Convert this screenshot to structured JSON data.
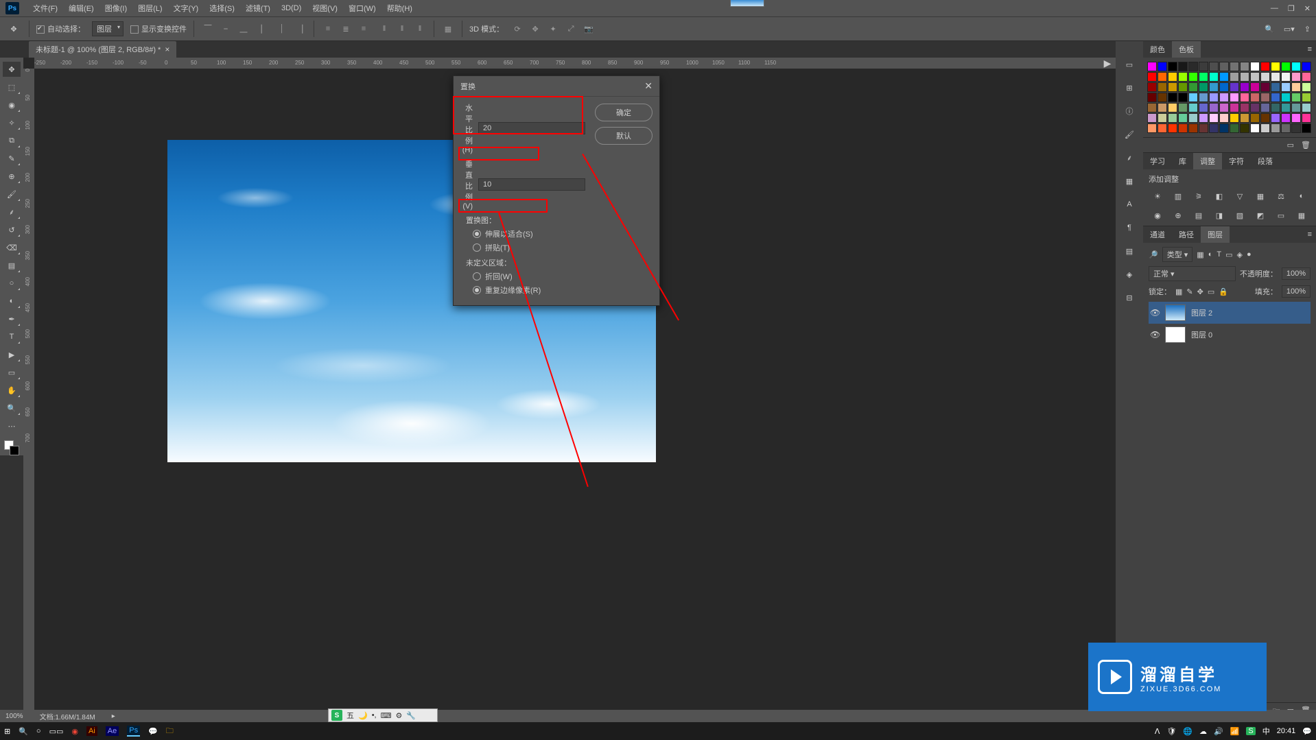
{
  "menubar": {
    "items": [
      "文件(F)",
      "编辑(E)",
      "图像(I)",
      "图层(L)",
      "文字(Y)",
      "选择(S)",
      "滤镜(T)",
      "3D(D)",
      "视图(V)",
      "窗口(W)",
      "帮助(H)"
    ]
  },
  "optbar": {
    "auto_select_label": "自动选择：",
    "auto_select_value": "图层",
    "show_transform_label": "显示变换控件",
    "mode3d_label": "3D 模式："
  },
  "tab": {
    "title": "未标题-1 @ 100% (图层 2, RGB/8#) *"
  },
  "ruler_h": [
    -250,
    -200,
    -150,
    -100,
    -50,
    0,
    50,
    100,
    150,
    200,
    250,
    300,
    350,
    400,
    450,
    500,
    550,
    600,
    650,
    700,
    750,
    800,
    850,
    900,
    950,
    1000,
    1050,
    1100,
    1150
  ],
  "ruler_v": [
    0,
    50,
    100,
    150,
    200,
    250,
    300,
    350,
    400,
    450,
    500,
    550,
    600,
    650,
    700
  ],
  "dialog": {
    "title": "置换",
    "h_ratio_label": "水平比例(H)",
    "h_ratio_value": "20",
    "v_ratio_label": "垂直比例(V)",
    "v_ratio_value": "10",
    "group1_label": "置换图：",
    "opt_stretch": "伸展以适合(S)",
    "opt_tile": "拼贴(T)",
    "group2_label": "未定义区域：",
    "opt_wrap": "折回(W)",
    "opt_repeat": "重复边缘像素(R)",
    "ok": "确定",
    "default": "默认"
  },
  "panels": {
    "color_tabs": [
      "颜色",
      "色板"
    ],
    "adjust_tabs": [
      "学习",
      "库",
      "调整",
      "字符",
      "段落"
    ],
    "adjust_title": "添加调整",
    "layers_tabs": [
      "通道",
      "路径",
      "图层"
    ],
    "layer_filter_label": "类型",
    "blend_mode": "正常",
    "opacity_label": "不透明度：",
    "opacity_value": "100%",
    "lock_label": "锁定：",
    "fill_label": "填充：",
    "fill_value": "100%",
    "layers": [
      {
        "name": "图层 2",
        "visible": true,
        "thumb": "sky"
      },
      {
        "name": "图层 0",
        "visible": true,
        "thumb": "white"
      }
    ]
  },
  "status": {
    "zoom": "100%",
    "doc": "文档:1.66M/1.84M"
  },
  "ime": {
    "label": "五"
  },
  "taskbar": {
    "time": "20:41"
  },
  "watermark": {
    "big": "溜溜自学",
    "small": "ZIXUE.3D66.COM"
  },
  "swatches": [
    "#ff00ff",
    "#0000ff",
    "#000000",
    "#181818",
    "#2a2a2a",
    "#3c3c3c",
    "#4e4e4e",
    "#606060",
    "#727272",
    "#848484",
    "#ffffff",
    "#ff0000",
    "#ffff00",
    "#00ff00",
    "#00ffff",
    "#0000ff",
    "#ff0000",
    "#ff6600",
    "#ffcc00",
    "#99ff00",
    "#33ff00",
    "#00ff66",
    "#00ffcc",
    "#0099ff",
    "#9f9f9f",
    "#b1b1b1",
    "#c3c3c3",
    "#d5d5d5",
    "#e7e7e7",
    "#f3f3f3",
    "#ff99cc",
    "#ff6699",
    "#990000",
    "#996600",
    "#cc9900",
    "#669900",
    "#339933",
    "#009966",
    "#3399cc",
    "#0066cc",
    "#6633cc",
    "#9900cc",
    "#cc0099",
    "#660033",
    "#336699",
    "#99ccff",
    "#ffcc99",
    "#ccff99",
    "#660000",
    "#663300",
    "#000000",
    "#000000",
    "#66ccff",
    "#6699cc",
    "#9999ff",
    "#cc99ff",
    "#ff99ff",
    "#ff6699",
    "#cc6666",
    "#996666",
    "#3366cc",
    "#00cccc",
    "#66cc66",
    "#99cc33",
    "#996633",
    "#cc9966",
    "#ffcc66",
    "#669966",
    "#66cccc",
    "#6666cc",
    "#9966cc",
    "#cc66cc",
    "#cc3399",
    "#993366",
    "#663366",
    "#666699",
    "#336666",
    "#339999",
    "#669999",
    "#99cccc",
    "#cc99cc",
    "#cccc99",
    "#99cc99",
    "#66cc99",
    "#99ccCC",
    "#cc99ff",
    "#ffccff",
    "#ffcccc",
    "#ffcc00",
    "#cc9933",
    "#996600",
    "#663300",
    "#9966ff",
    "#cc33ff",
    "#ff66ff",
    "#ff3399",
    "#ff9966",
    "#ff6633",
    "#ff3300",
    "#cc3300",
    "#993300",
    "#663333",
    "#333366",
    "#003366",
    "#336633",
    "#333300",
    "#ffffff",
    "#cccccc",
    "#999999",
    "#666666",
    "#333333",
    "#000000"
  ]
}
